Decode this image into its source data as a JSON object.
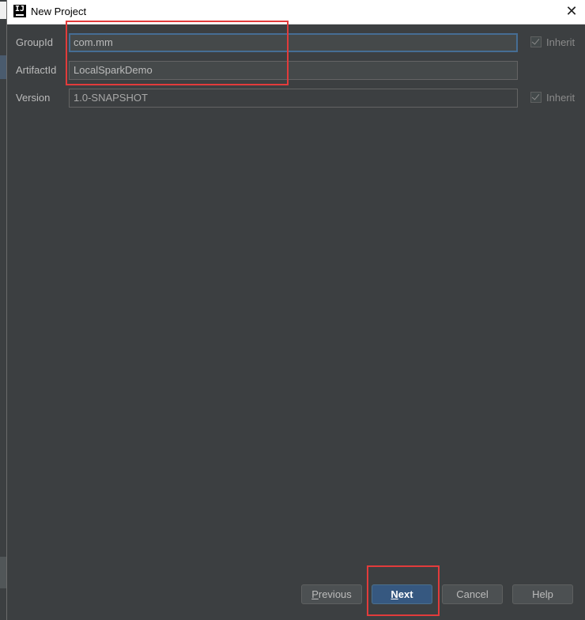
{
  "window": {
    "title": "New Project",
    "close_glyph": "✕",
    "icon_letter": "IJ"
  },
  "form": {
    "group_id": {
      "label": "GroupId",
      "value": "com.mm",
      "inherit_label": "Inherit"
    },
    "artifact_id": {
      "label": "ArtifactId",
      "value": "LocalSparkDemo"
    },
    "version": {
      "label": "Version",
      "value": "1.0-SNAPSHOT",
      "inherit_label": "Inherit"
    }
  },
  "buttons": {
    "previous": {
      "mnemonic": "P",
      "rest": "revious"
    },
    "next": {
      "mnemonic": "N",
      "rest": "ext"
    },
    "cancel": "Cancel",
    "help": "Help"
  },
  "colors": {
    "dialog_bg": "#3c3f41",
    "field_bg": "#45494a",
    "focus_border": "#466d94",
    "primary_button": "#365880",
    "annotation": "#e23b3b"
  }
}
